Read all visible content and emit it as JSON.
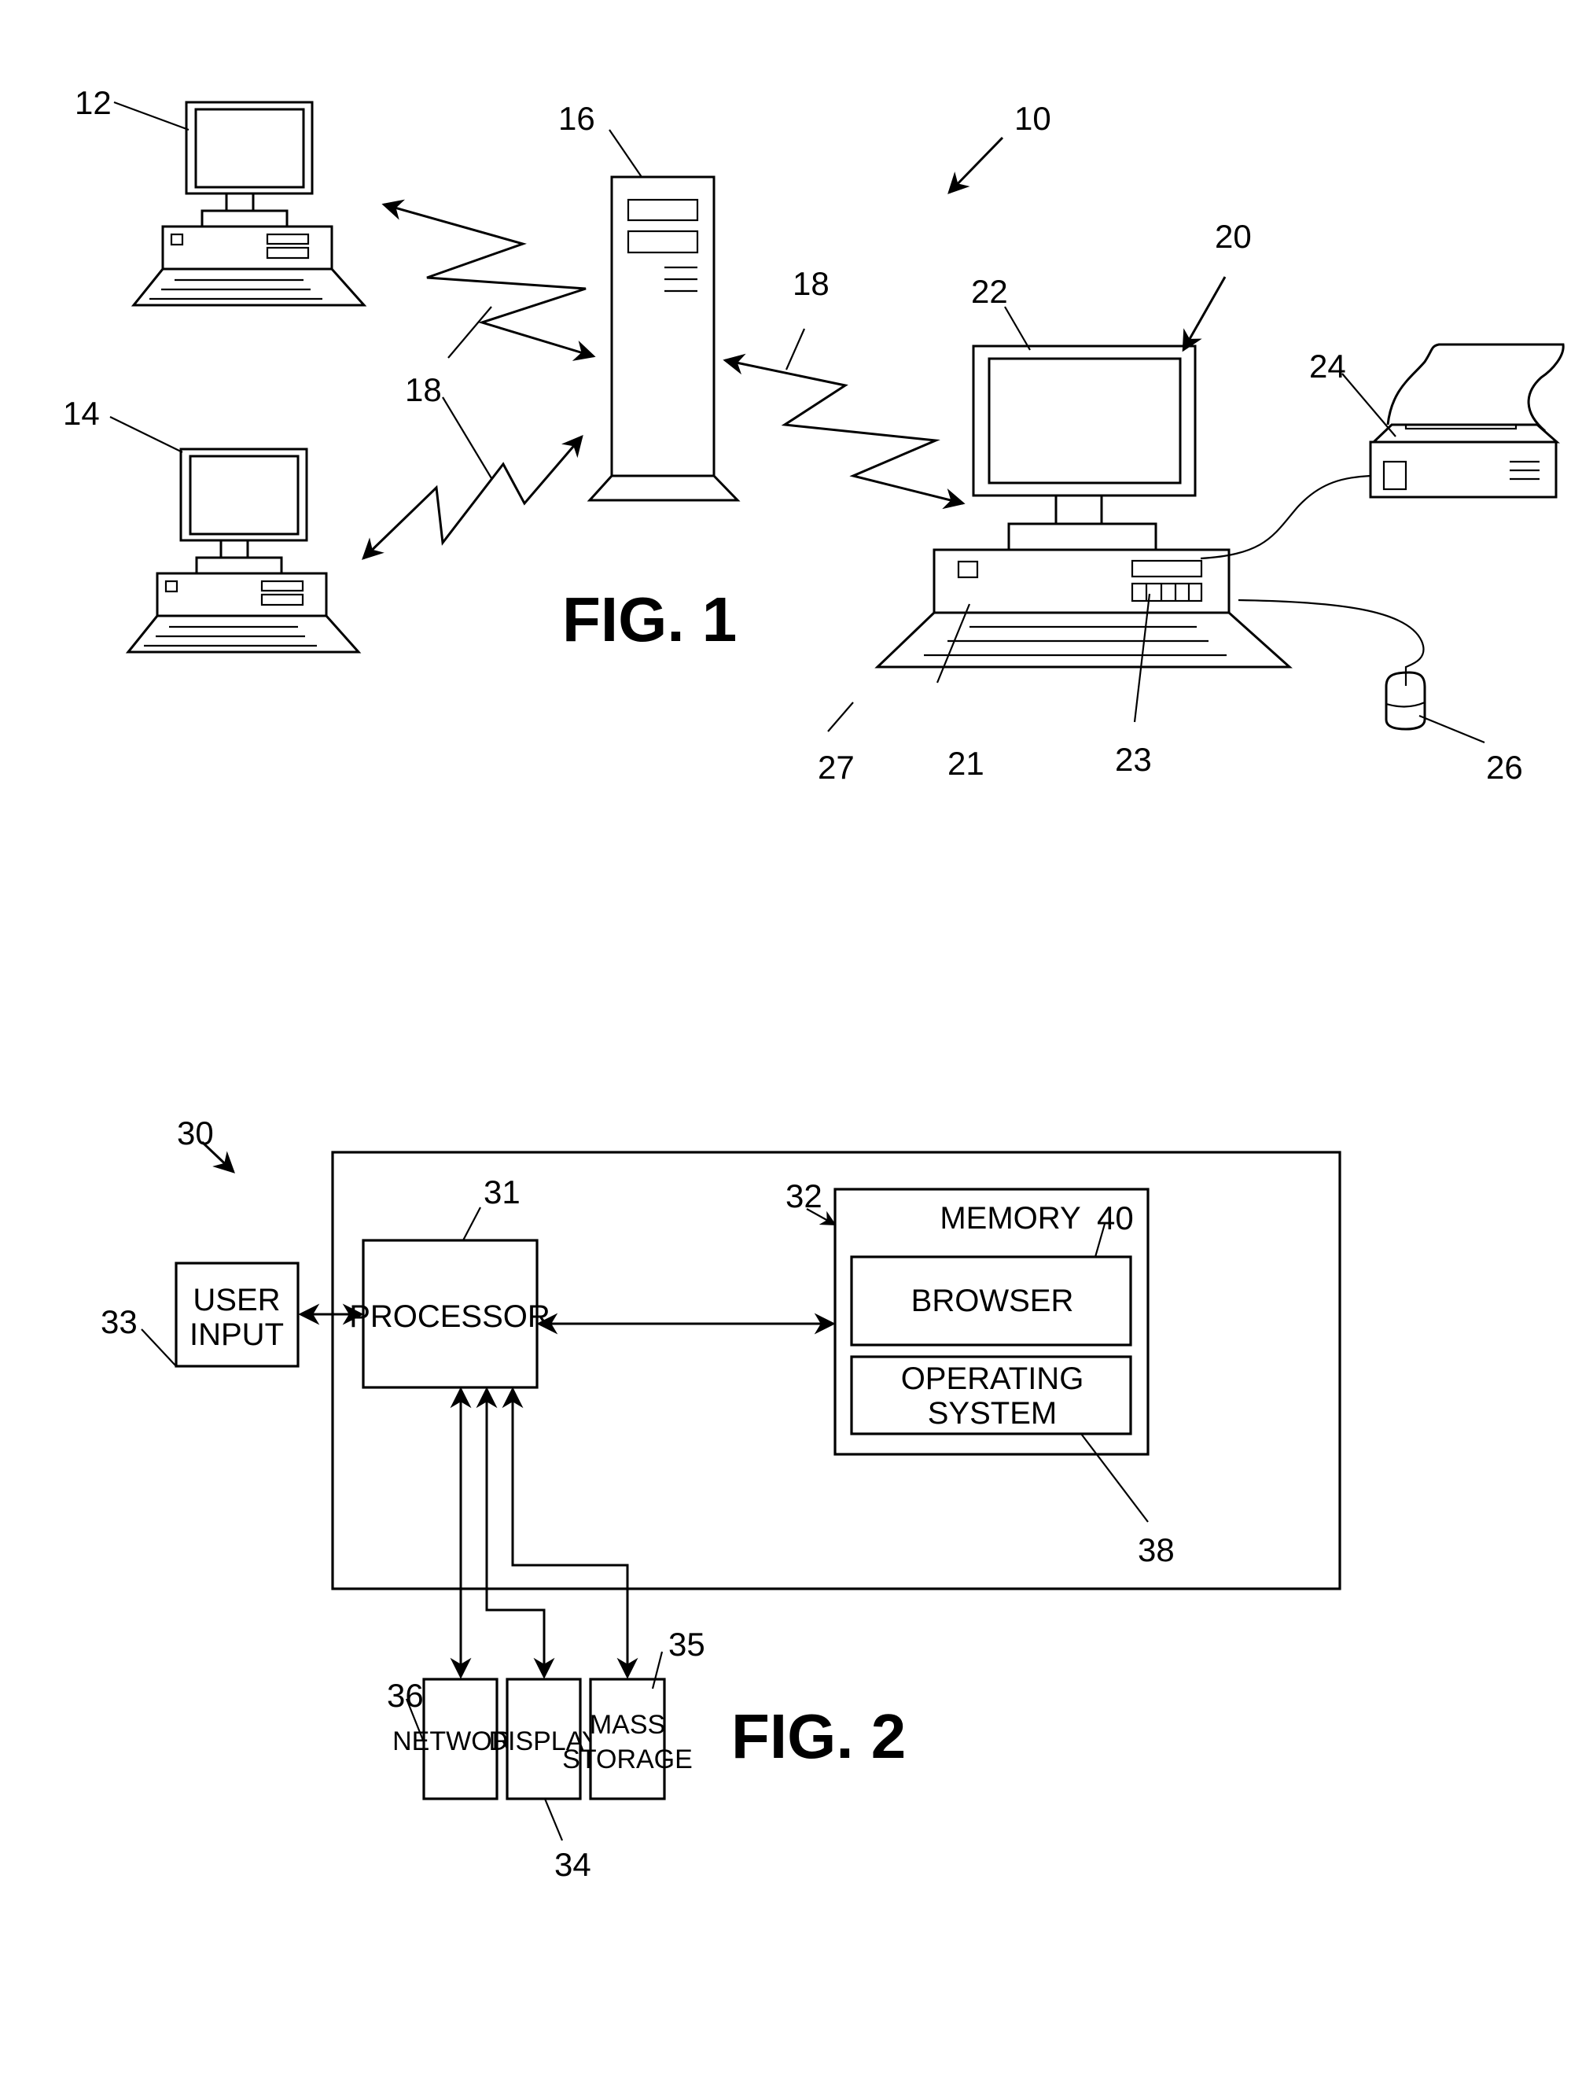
{
  "fig1": {
    "title": "FIG. 1",
    "refs": {
      "system": "10",
      "client_top": "12",
      "client_bottom": "14",
      "server": "16",
      "link_a": "18",
      "link_b": "18",
      "workstation": "20",
      "cpu_unit": "21",
      "monitor": "22",
      "drive_bays": "23",
      "printer": "24",
      "mouse": "26",
      "keyboard": "27"
    }
  },
  "fig2": {
    "title": "FIG. 2",
    "refs": {
      "system": "30",
      "processor": "31",
      "memory": "32",
      "user_input": "33",
      "display": "34",
      "mass_storage": "35",
      "network": "36",
      "operating_system": "38",
      "browser": "40"
    },
    "labels": {
      "user_input_1": "USER",
      "user_input_2": "INPUT",
      "processor": "PROCESSOR",
      "memory": "MEMORY",
      "browser": "BROWSER",
      "os_1": "OPERATING",
      "os_2": "SYSTEM",
      "network": "NETWORK",
      "display": "DISPLAY",
      "mass_storage_1": "MASS",
      "mass_storage_2": "STORAGE"
    }
  }
}
